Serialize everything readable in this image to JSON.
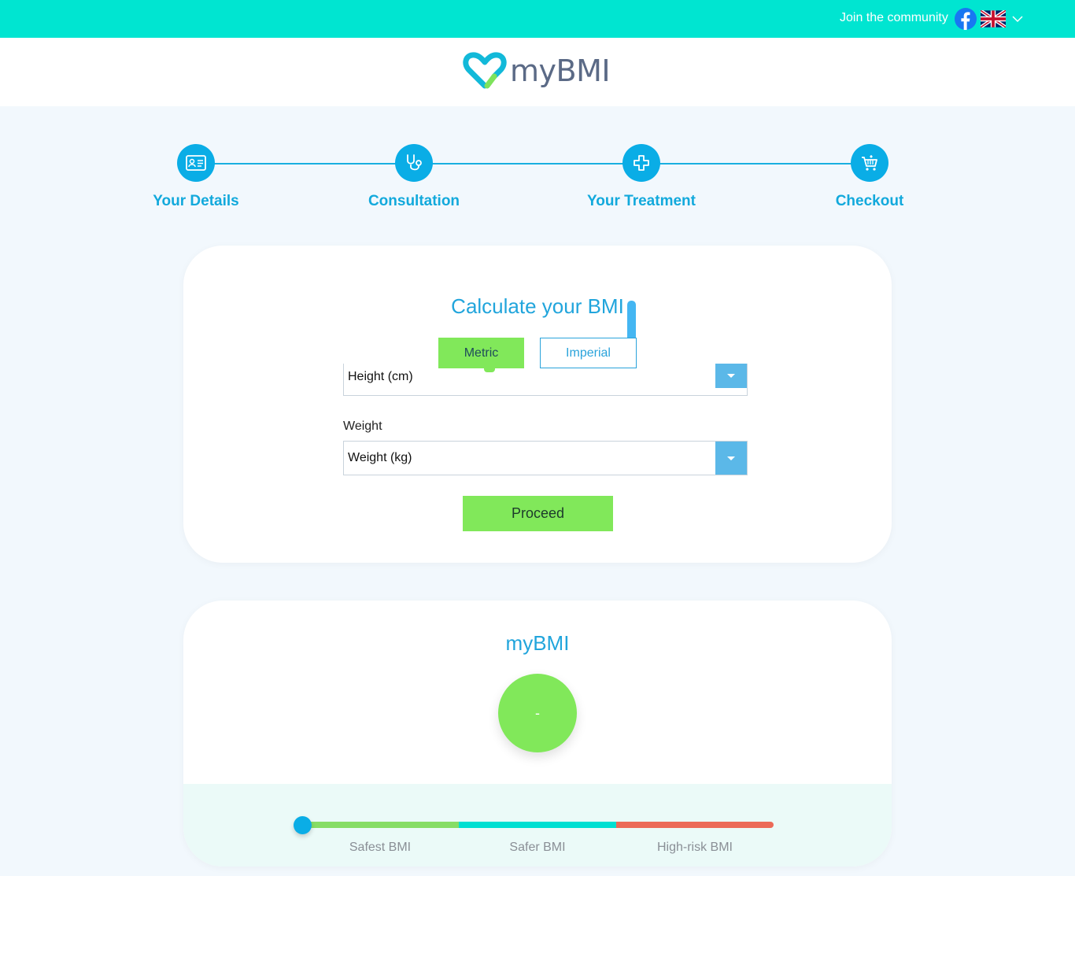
{
  "topbar": {
    "join_text": "Join the community",
    "icons": [
      "facebook-icon",
      "uk-flag-icon",
      "chevron-down-icon"
    ]
  },
  "header": {
    "logo_text": "myBMI",
    "logo_icon": "heart-logo-icon"
  },
  "steps": [
    {
      "label": "Your Details",
      "icon": "id-card-icon"
    },
    {
      "label": "Consultation",
      "icon": "stethoscope-icon"
    },
    {
      "label": "Your Treatment",
      "icon": "medical-cross-icon"
    },
    {
      "label": "Checkout",
      "icon": "cart-icon"
    }
  ],
  "calculator": {
    "title": "Calculate your BMI",
    "unit_tabs": {
      "metric": "Metric",
      "imperial": "Imperial",
      "selected": "Metric"
    },
    "height_select_value": "Height (cm)",
    "weight_label": "Weight",
    "weight_select_value": "Weight (kg)",
    "proceed_label": "Proceed"
  },
  "result": {
    "title": "myBMI",
    "value": "-",
    "scale_labels": [
      "Safest BMI",
      "Safer BMI",
      "High-risk BMI"
    ],
    "scale_colors": [
      "#86dd66",
      "#00dfd2",
      "#ec6a58"
    ],
    "indicator_position": 0
  },
  "colors": {
    "topbar": "#00e5d1",
    "accent_blue": "#0aade6",
    "accent_green": "#81e85a",
    "page_bg": "#f2f8fd"
  }
}
